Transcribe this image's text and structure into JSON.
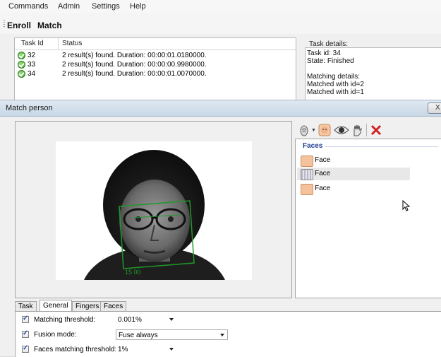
{
  "menu": [
    "Commands",
    "Admin",
    "Settings",
    "Help"
  ],
  "top_tabs": [
    "Enroll",
    "Match"
  ],
  "task_table": {
    "headers": [
      "Task Id",
      "Status"
    ],
    "rows": [
      {
        "id": "32",
        "status": "2 result(s) found. Duration: 00:00:01.0180000."
      },
      {
        "id": "33",
        "status": "2 result(s) found. Duration: 00:00:00.9980000."
      },
      {
        "id": "34",
        "status": "2 result(s) found. Duration: 00:00:01.0070000."
      }
    ]
  },
  "task_details": {
    "label": "Task details:",
    "lines": [
      "Task id: 34",
      "State: Finished",
      "",
      "Matching details:",
      "Matched with id=2",
      "Matched with id=1"
    ]
  },
  "dialog": {
    "title": "Match person",
    "close_label": "X"
  },
  "photo": {
    "face_box_label": "15 00"
  },
  "faces_panel": {
    "header": "Faces",
    "items": [
      "Face",
      "Face",
      "Face"
    ]
  },
  "bottom_tabs": [
    "Task",
    "General",
    "Fingers",
    "Faces"
  ],
  "options": {
    "matching_threshold_label": "Matching threshold:",
    "matching_threshold_value": "0.001%",
    "fusion_mode_label": "Fusion mode:",
    "fusion_mode_value": "Fuse always",
    "faces_threshold_label": "Faces matching threshold:",
    "faces_threshold_value": "1%"
  },
  "icons": {
    "status_ok": "check-circle-icon",
    "fingerprint": "fingerprint-icon",
    "face": "face-icon",
    "iris": "eye-icon",
    "palm": "hand-icon",
    "delete": "red-x-icon"
  },
  "colors": {
    "titlebar": "#cfdcea",
    "faces_header": "#1e3d8f",
    "face_box": "#1f9a2a",
    "delete_red": "#d21f1f"
  }
}
